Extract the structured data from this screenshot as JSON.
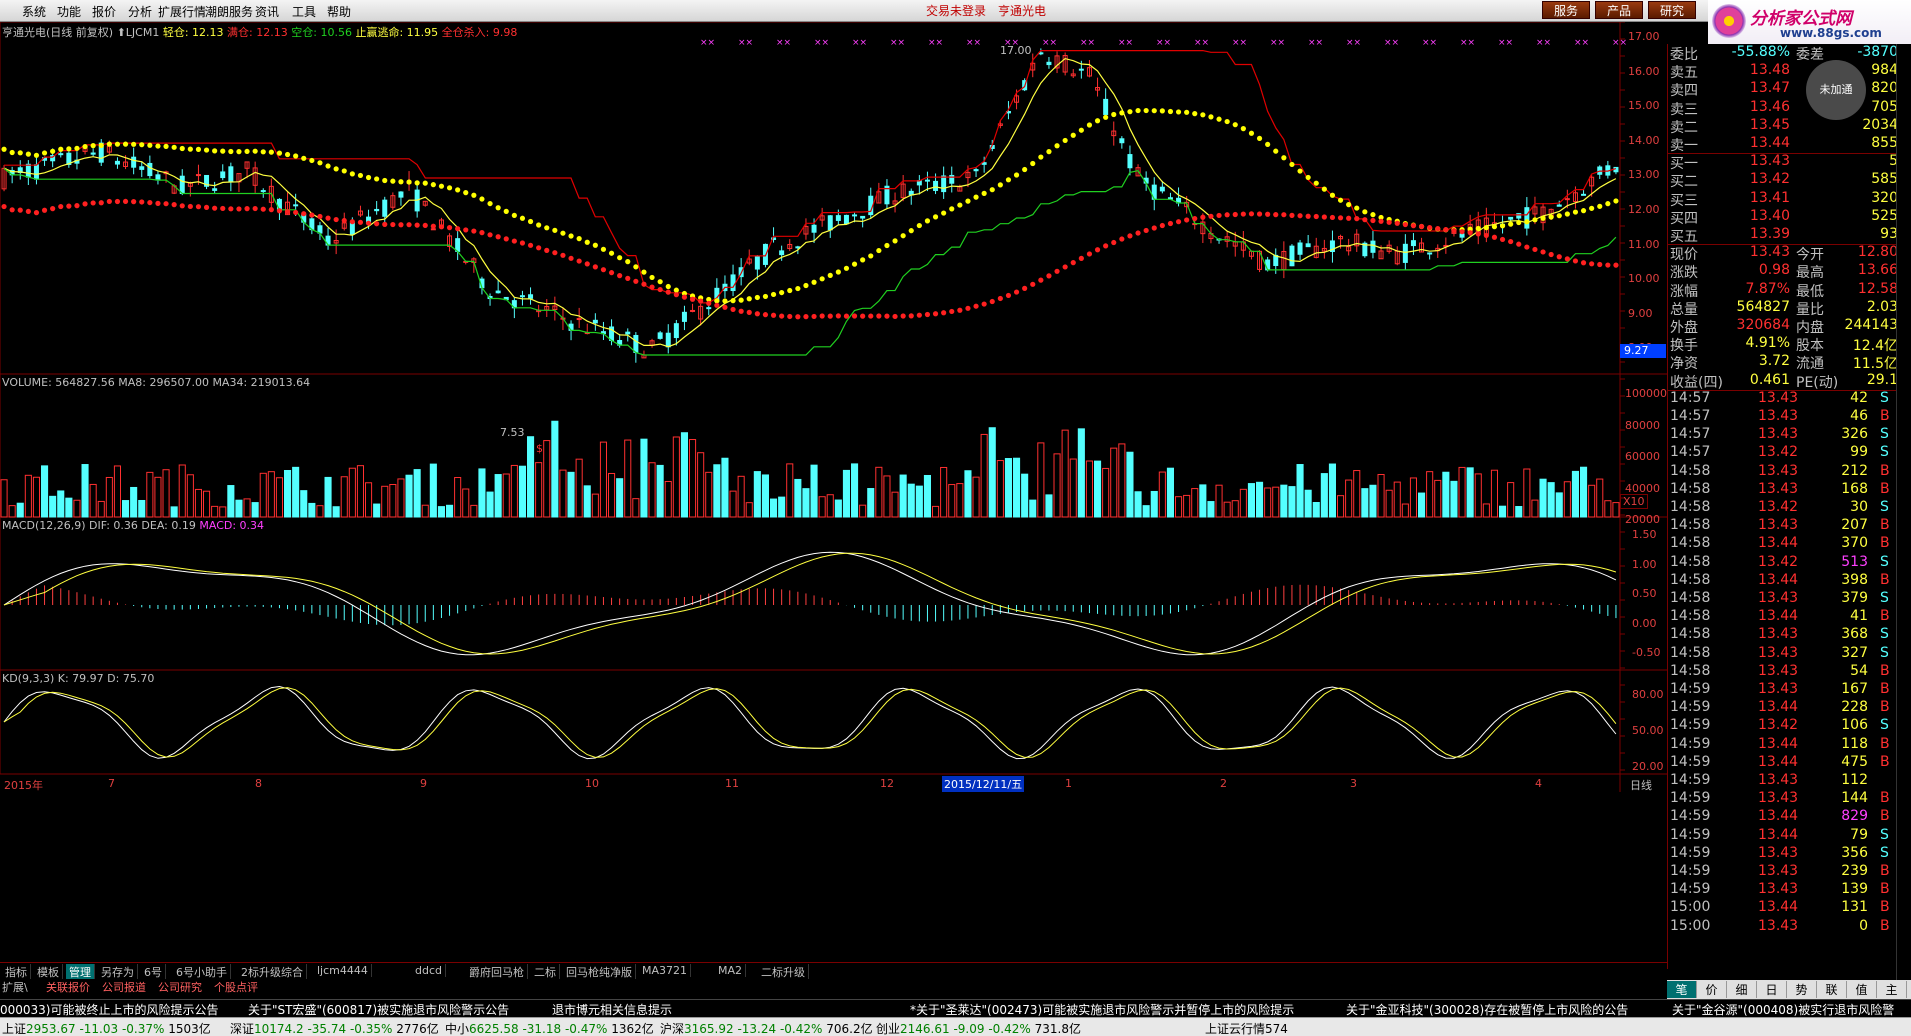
{
  "menu": [
    "系统",
    "功能",
    "报价",
    "分析",
    "扩展行情",
    "潮朗服务",
    "资讯",
    "工具",
    "帮助"
  ],
  "top_status": {
    "login": "交易未登录",
    "stock": "亨通光电"
  },
  "top_buttons": [
    "服务",
    "产品",
    "研究"
  ],
  "logo": {
    "text": "分析家公式网",
    "url": "www.88gs.com"
  },
  "chart_header": {
    "title": "亨通光电(日线 前复权)",
    "indicator": "LJCM1",
    "light": "轻仓: 12.13",
    "heavy": "满仓: 12.13",
    "empty": "空仓: 10.56",
    "stoploss": "止赢逃命: 11.95",
    "full_buy": "全仓杀入: 9.98"
  },
  "main_axis": [
    "17.00",
    "16.00",
    "15.00",
    "14.00",
    "13.00",
    "12.00",
    "11.00",
    "10.00",
    "9.00",
    "8.00"
  ],
  "annotations": {
    "high": "17.00",
    "low": "7.53",
    "price_tag": "9.27",
    "dollar": "$"
  },
  "volume": {
    "header": "VOLUME: 564827.56  MA8: 296507.00  MA34: 219013.64",
    "axis": [
      "100000",
      "80000",
      "60000",
      "40000",
      "20000"
    ],
    "unit": "X10"
  },
  "macd": {
    "header_prefix": "MACD(12,26,9)  DIF: 0.36  DEA: 0.19",
    "macd_value": "MACD: 0.34",
    "axis": [
      "1.50",
      "1.00",
      "0.50",
      "0.00",
      "-0.50"
    ]
  },
  "kd": {
    "header": "KD(9,3,3)  K: 79.97  D: 75.70",
    "axis": [
      "80.00",
      "50.00",
      "20.00"
    ]
  },
  "date_axis": {
    "labels": [
      "2015年",
      "7",
      "8",
      "9",
      "10",
      "11",
      "12",
      "1",
      "2",
      "3",
      "4"
    ],
    "highlight": "2015/12/11/五",
    "period": "日线"
  },
  "tabs": [
    "指标",
    "模板",
    "管理",
    "另存为",
    "6号",
    "6号小助手",
    "2标升级综合",
    "ljcm4444",
    "ddcd",
    "爵府回马枪",
    "二标",
    "回马枪纯净版",
    "MA3721",
    "MA2",
    "二标升级"
  ],
  "tabs2": [
    "扩展\\",
    "关联报价",
    "公司报道",
    "公司研究",
    "个股点评"
  ],
  "quote": {
    "webi": {
      "label": "委比",
      "value": "-55.88%",
      "label2": "委差",
      "value2": "-3870"
    },
    "asks": [
      {
        "l": "卖五",
        "p": "13.48",
        "v": "984"
      },
      {
        "l": "卖四",
        "p": "13.47",
        "v": "820"
      },
      {
        "l": "卖三",
        "p": "13.46",
        "v": "705"
      },
      {
        "l": "卖二",
        "p": "13.45",
        "v": "2034"
      },
      {
        "l": "卖一",
        "p": "13.44",
        "v": "855"
      }
    ],
    "bids": [
      {
        "l": "买一",
        "p": "13.43",
        "v": "5"
      },
      {
        "l": "买二",
        "p": "13.42",
        "v": "585"
      },
      {
        "l": "买三",
        "p": "13.41",
        "v": "320"
      },
      {
        "l": "买四",
        "p": "13.40",
        "v": "525"
      },
      {
        "l": "买五",
        "p": "13.39",
        "v": "93"
      }
    ],
    "stats": [
      {
        "l1": "现价",
        "v1": "13.43",
        "l2": "今开",
        "v2": "12.80"
      },
      {
        "l1": "涨跌",
        "v1": "0.98",
        "l2": "最高",
        "v2": "13.66"
      },
      {
        "l1": "涨幅",
        "v1": "7.87%",
        "l2": "最低",
        "v2": "12.58"
      },
      {
        "l1": "总量",
        "v1": "564827",
        "l2": "量比",
        "v2": "2.03"
      },
      {
        "l1": "外盘",
        "v1": "320684",
        "l2": "内盘",
        "v2": "244143"
      },
      {
        "l1": "换手",
        "v1": "4.91%",
        "l2": "股本",
        "v2": "12.4亿"
      },
      {
        "l1": "净资",
        "v1": "3.72",
        "l2": "流通",
        "v2": "11.5亿"
      },
      {
        "l1": "收益(四)",
        "v1": "0.461",
        "l2": "PE(动)",
        "v2": "29.1"
      }
    ],
    "not_added": "未加通",
    "ticks": [
      {
        "t": "14:57",
        "p": "13.43",
        "v": "42",
        "s": "S"
      },
      {
        "t": "14:57",
        "p": "13.43",
        "v": "46",
        "s": "B"
      },
      {
        "t": "14:57",
        "p": "13.43",
        "v": "326",
        "s": "S"
      },
      {
        "t": "14:57",
        "p": "13.42",
        "v": "99",
        "s": "S"
      },
      {
        "t": "14:58",
        "p": "13.43",
        "v": "212",
        "s": "B"
      },
      {
        "t": "14:58",
        "p": "13.43",
        "v": "168",
        "s": "B"
      },
      {
        "t": "14:58",
        "p": "13.42",
        "v": "30",
        "s": "S"
      },
      {
        "t": "14:58",
        "p": "13.43",
        "v": "207",
        "s": "B"
      },
      {
        "t": "14:58",
        "p": "13.44",
        "v": "370",
        "s": "B"
      },
      {
        "t": "14:58",
        "p": "13.42",
        "v": "513",
        "s": "S"
      },
      {
        "t": "14:58",
        "p": "13.44",
        "v": "398",
        "s": "B"
      },
      {
        "t": "14:58",
        "p": "13.43",
        "v": "379",
        "s": "S"
      },
      {
        "t": "14:58",
        "p": "13.44",
        "v": "41",
        "s": "B"
      },
      {
        "t": "14:58",
        "p": "13.43",
        "v": "368",
        "s": "S"
      },
      {
        "t": "14:58",
        "p": "13.43",
        "v": "327",
        "s": "S"
      },
      {
        "t": "14:58",
        "p": "13.43",
        "v": "54",
        "s": "B"
      },
      {
        "t": "14:59",
        "p": "13.43",
        "v": "167",
        "s": "B"
      },
      {
        "t": "14:59",
        "p": "13.44",
        "v": "228",
        "s": "B"
      },
      {
        "t": "14:59",
        "p": "13.42",
        "v": "106",
        "s": "S"
      },
      {
        "t": "14:59",
        "p": "13.44",
        "v": "118",
        "s": "B"
      },
      {
        "t": "14:59",
        "p": "13.44",
        "v": "475",
        "s": "B"
      },
      {
        "t": "14:59",
        "p": "13.43",
        "v": "112",
        "s": ""
      },
      {
        "t": "14:59",
        "p": "13.43",
        "v": "144",
        "s": "B"
      },
      {
        "t": "14:59",
        "p": "13.44",
        "v": "829",
        "s": "B"
      },
      {
        "t": "14:59",
        "p": "13.44",
        "v": "79",
        "s": "S"
      },
      {
        "t": "14:59",
        "p": "13.43",
        "v": "356",
        "s": "S"
      },
      {
        "t": "14:59",
        "p": "13.43",
        "v": "239",
        "s": "B"
      },
      {
        "t": "14:59",
        "p": "13.43",
        "v": "139",
        "s": "B"
      },
      {
        "t": "15:00",
        "p": "13.44",
        "v": "131",
        "s": "B"
      },
      {
        "t": "15:00",
        "p": "13.43",
        "v": "0",
        "s": "B"
      }
    ]
  },
  "quote_tabs": [
    "笔",
    "价",
    "细",
    "日",
    "势",
    "联",
    "值",
    "主"
  ],
  "news": [
    {
      "t": "000033)可能被终止上市的风险提示公告",
      "c": "#ffffff"
    },
    {
      "t": "关于\"ST宏盛\"(600817)被实施退市风险警示公告",
      "c": "#ffffff"
    },
    {
      "t": "退市博元相关信息提示",
      "c": "#ffffff"
    },
    {
      "t": "*关于\"圣莱达\"(002473)可能被实施退市风险警示并暂停上市的风险提示",
      "c": "#ffffff"
    },
    {
      "t": "关于\"金亚科技\"(300028)存在被暂停上市风险的公告",
      "c": "#ffffff"
    },
    {
      "t": "关于\"金谷源\"(000408)被实行退市风险警",
      "c": "#ffffff"
    }
  ],
  "status": [
    {
      "name": "上证",
      "val": "2953.67",
      "chg": "-11.03",
      "pct": "-0.37%",
      "amt": "1503亿"
    },
    {
      "name": "深证",
      "val": "10174.2",
      "chg": "-35.74",
      "pct": "-0.35%",
      "amt": "2776亿"
    },
    {
      "name": "中小",
      "val": "6625.58",
      "chg": "-31.18",
      "pct": "-0.47%",
      "amt": "1362亿"
    },
    {
      "name": "沪深",
      "val": "3165.92",
      "chg": "-13.24",
      "pct": "-0.42%",
      "amt": "706.2亿"
    },
    {
      "name": "创业",
      "val": "2146.61",
      "chg": "-9.09",
      "pct": "-0.42%",
      "amt": "731.8亿"
    }
  ],
  "status_right": "上证云行情574"
}
